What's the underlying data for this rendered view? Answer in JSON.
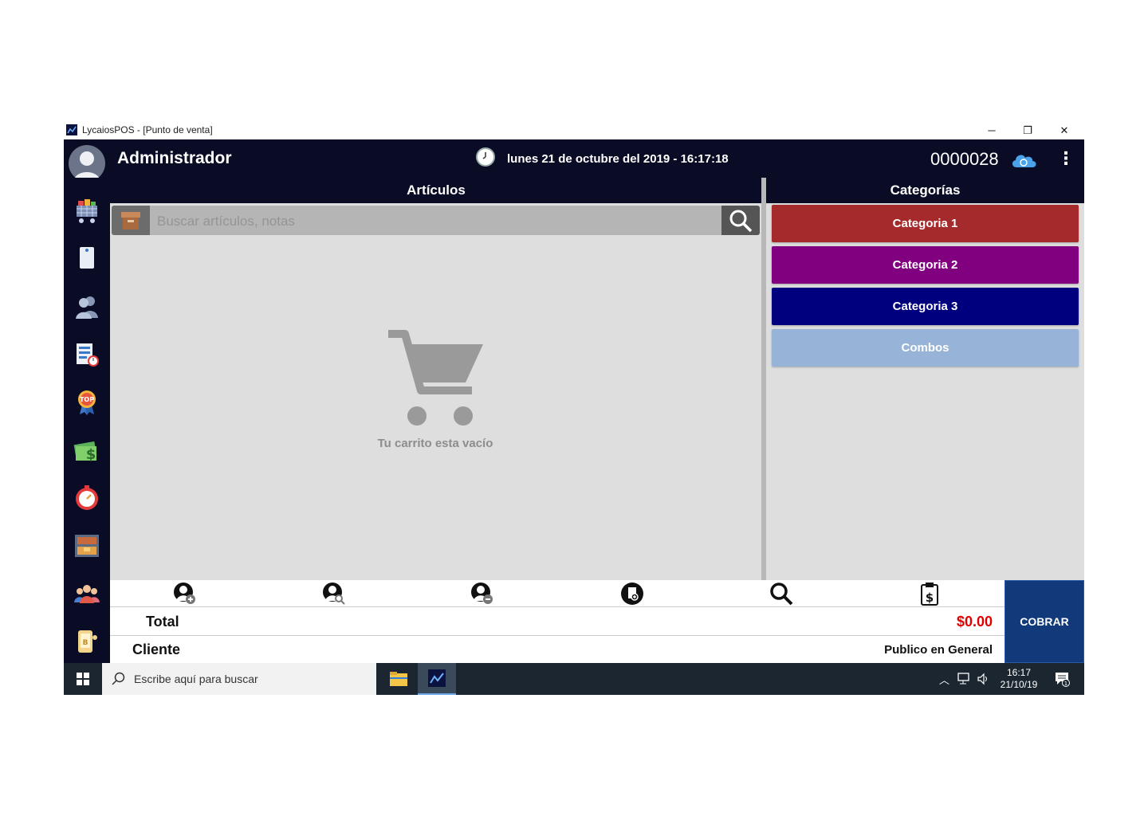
{
  "window": {
    "title": "LycaiosPOS - [Punto de venta]",
    "minimize": "─",
    "restore": "❐",
    "close": "✕"
  },
  "header": {
    "user_name": "Administrador",
    "datetime": "lunes 21 de octubre del 2019 - 16:17:18",
    "ticket_number": "0000028",
    "menu": "⋮"
  },
  "sidebar": {
    "items": [
      "pos-cart-icon",
      "notes-icon",
      "users-icon",
      "reports-clock-icon",
      "top-badge-icon",
      "money-icon",
      "timer-icon",
      "warehouse-icon",
      "team-icon",
      "mobile-icon"
    ]
  },
  "articles": {
    "title": "Artículos",
    "search_placeholder": "Buscar artículos, notas",
    "empty_message": "Tu carrito esta vacío"
  },
  "categories": {
    "title": "Categorías",
    "items": [
      {
        "label": "Categoria 1",
        "color": "#a42a2c"
      },
      {
        "label": "Categoria 2",
        "color": "#800080"
      },
      {
        "label": "Categoria 3",
        "color": "#00007f"
      },
      {
        "label": "Combos",
        "color": "#97b4d8"
      }
    ]
  },
  "summary": {
    "total_label": "Total",
    "total_value": "$0.00",
    "client_label": "Cliente",
    "client_value": "Publico en General",
    "charge_button": "COBRAR"
  },
  "taskbar": {
    "search_placeholder": "Escribe aquí para buscar",
    "time": "16:17",
    "date": "21/10/19"
  },
  "colors": {
    "header_bg": "#0a0c26",
    "panel_bg": "#dedede",
    "total_red": "#e00000",
    "charge_blue": "#123a7a"
  }
}
